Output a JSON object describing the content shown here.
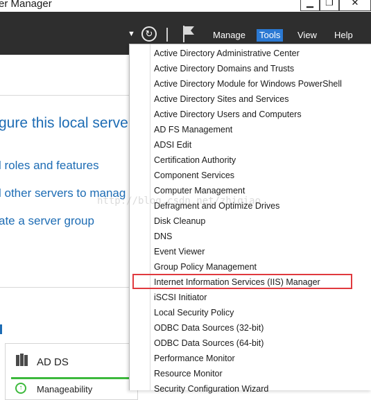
{
  "window": {
    "title": "er Manager",
    "min_glyph": "▁",
    "max_glyph": "❐",
    "close_glyph": "✕"
  },
  "toolbar": {
    "menus": [
      "Manage",
      "Tools",
      "View",
      "Help"
    ],
    "active_menu": "Tools",
    "active_color": "#2b79d3",
    "icons": [
      "caret-down-icon",
      "refresh-icon",
      "flag-icon"
    ]
  },
  "main": {
    "heading": "gure this local serve",
    "links": [
      "l roles and features",
      "l other servers to manag",
      "ate a server group"
    ],
    "tile": {
      "title": "AD DS",
      "status": "Manageability"
    }
  },
  "tools_menu": {
    "items": [
      "Active Directory Administrative Center",
      "Active Directory Domains and Trusts",
      "Active Directory Module for Windows PowerShell",
      "Active Directory Sites and Services",
      "Active Directory Users and Computers",
      "AD FS Management",
      "ADSI Edit",
      "Certification Authority",
      "Component Services",
      "Computer Management",
      "Defragment and Optimize Drives",
      "Disk Cleanup",
      "DNS",
      "Event Viewer",
      "Group Policy Management",
      "Internet Information Services (IIS) Manager",
      "iSCSI Initiator",
      "Local Security Policy",
      "ODBC Data Sources (32-bit)",
      "ODBC Data Sources (64-bit)",
      "Performance Monitor",
      "Resource Monitor",
      "Security Configuration Wizard"
    ],
    "highlighted_item": "Internet Information Services (IIS) Manager",
    "highlight_color": "#e0393e"
  },
  "watermark": "http://blog.csdn.net/zhiqiao"
}
